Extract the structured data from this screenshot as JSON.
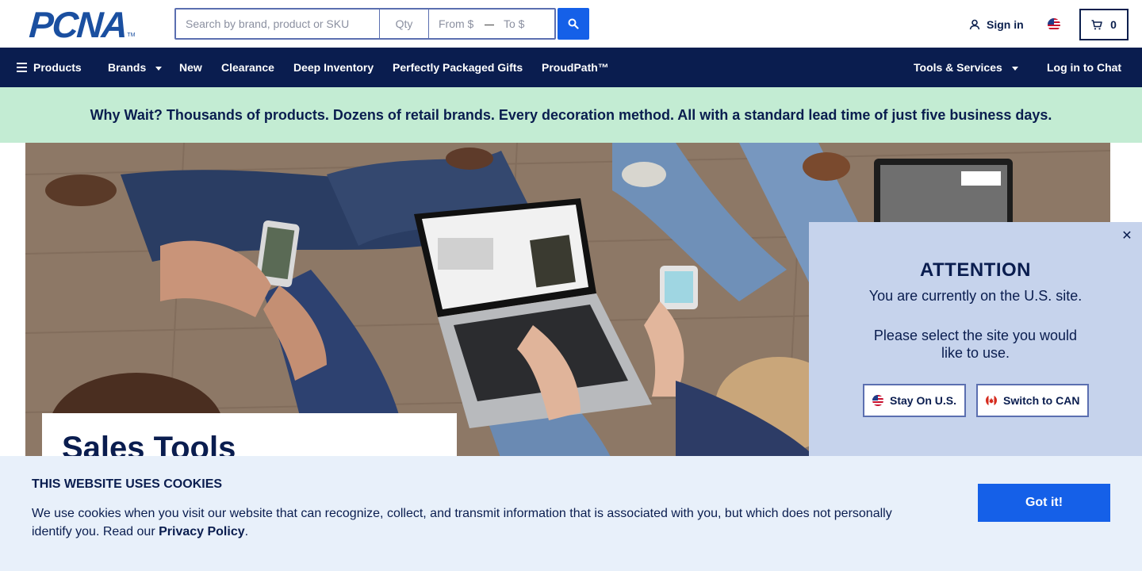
{
  "header": {
    "logo_text": "PCNA",
    "logo_tm": "TM",
    "search": {
      "main_placeholder": "Search by brand, product or SKU",
      "qty_placeholder": "Qty",
      "from_placeholder": "From $",
      "range_separator": "—",
      "to_placeholder": "To $"
    },
    "search_button_icon": "search-icon",
    "signin_label": "Sign in",
    "region_flag": "us-flag-icon",
    "cart_count": "0"
  },
  "nav": {
    "items": [
      {
        "label": "Products",
        "icon": "hamburger-icon"
      },
      {
        "label": "Brands",
        "dropdown": true
      },
      {
        "label": "New"
      },
      {
        "label": "Clearance"
      },
      {
        "label": "Deep Inventory"
      },
      {
        "label": "Perfectly Packaged Gifts"
      },
      {
        "label": "ProudPath™"
      },
      {
        "label": "Tools & Services",
        "dropdown": true
      },
      {
        "label": "Log in to Chat"
      }
    ]
  },
  "promo": {
    "text": "Why Wait? Thousands of products. Dozens of retail brands. Every decoration method. All with a standard lead time of just five business days."
  },
  "hero": {
    "title": "Sales Tools"
  },
  "attention": {
    "title": "ATTENTION",
    "line1": "You are currently on the U.S. site.",
    "line2": "Please select the site you would like to use.",
    "stay_label": "Stay On U.S.",
    "switch_label": "Switch to CAN",
    "close_symbol": "✕"
  },
  "cookie": {
    "title": "THIS WEBSITE USES COOKIES",
    "body_pre": "We use cookies when you visit our website that can recognize, collect, and transmit information that is associated with you, but which does not personally identify you. Read our ",
    "link": "Privacy Policy",
    "body_post": ".",
    "button": "Got it!"
  },
  "colors": {
    "navy": "#0a1d4f",
    "accent_blue": "#1560e8",
    "promo_green": "#c3ecd3",
    "popup_bg": "#c6d3ec",
    "cookie_bg": "#e8f0fa"
  }
}
